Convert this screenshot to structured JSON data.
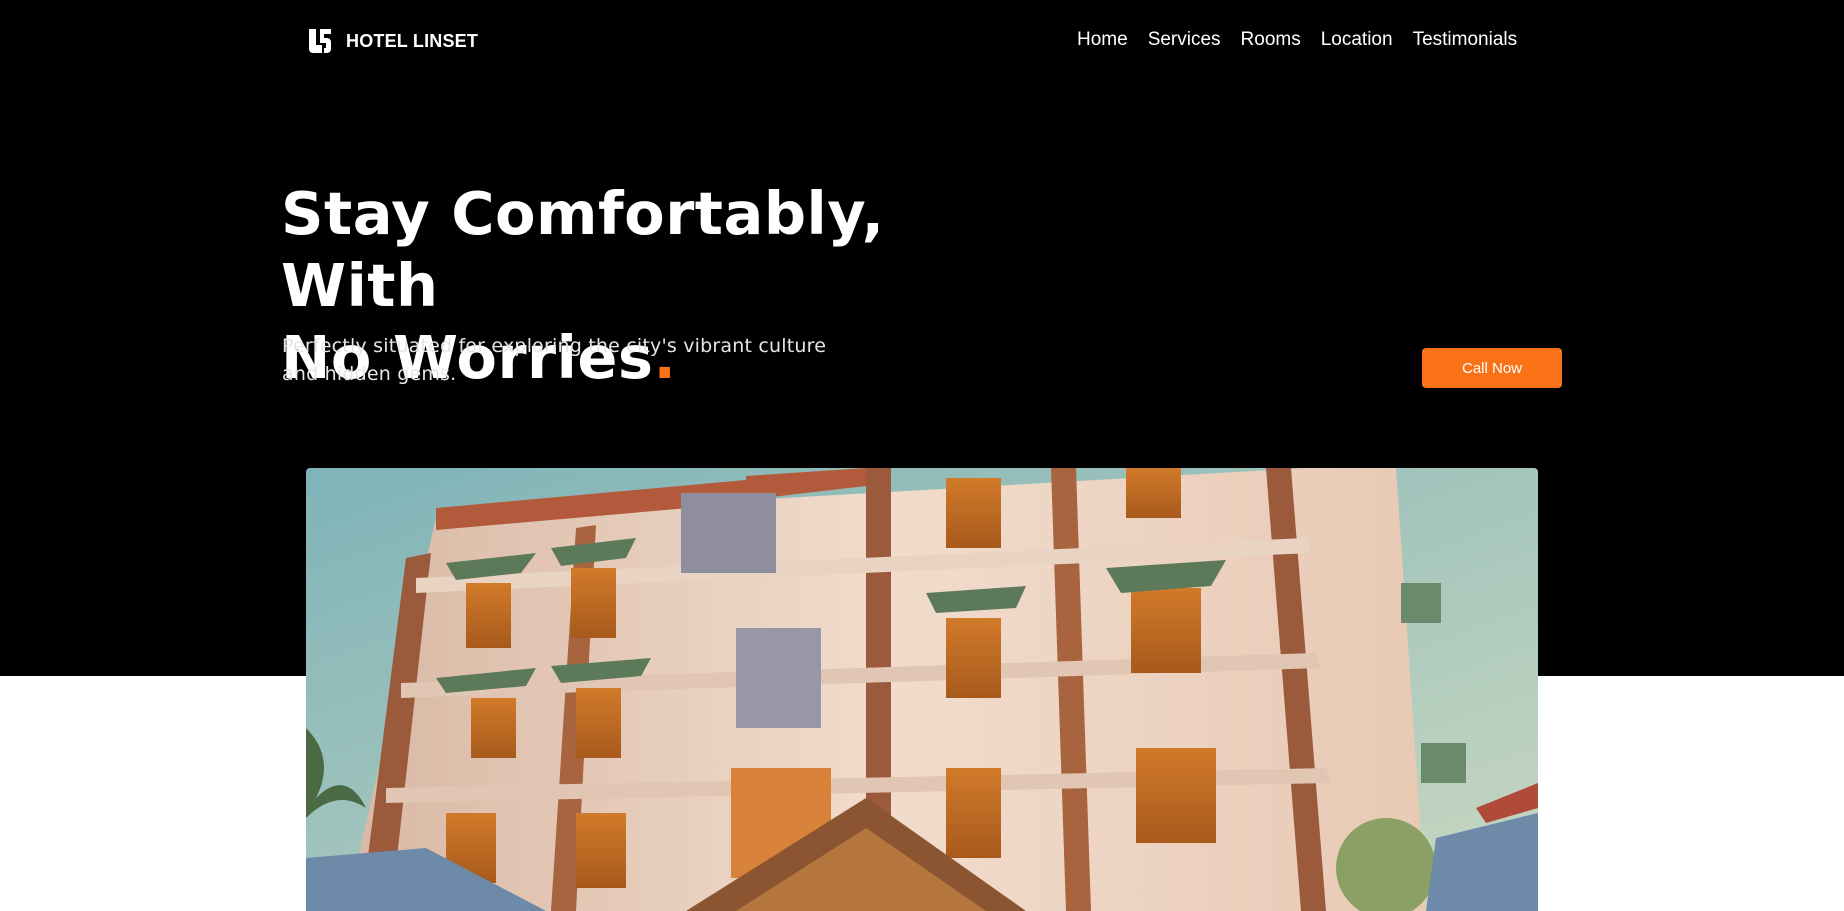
{
  "brand": {
    "name": "HOTEL LINSET",
    "logo_icon": "ls-monogram-icon"
  },
  "nav": {
    "items": [
      {
        "label": "Home"
      },
      {
        "label": "Services"
      },
      {
        "label": "Rooms"
      },
      {
        "label": "Location"
      },
      {
        "label": "Testimonials"
      }
    ]
  },
  "hero": {
    "headline_line1": "Stay Comfortably, With",
    "headline_line2": "No Worries",
    "headline_dot": ".",
    "subtitle_line1": "Perfectly situated for exploring the city's vibrant culture",
    "subtitle_line2": "and hidden gems.",
    "cta_label": "Call Now"
  },
  "colors": {
    "accent": "#f97316",
    "hero_background": "#000000",
    "page_background": "#ffffff"
  }
}
